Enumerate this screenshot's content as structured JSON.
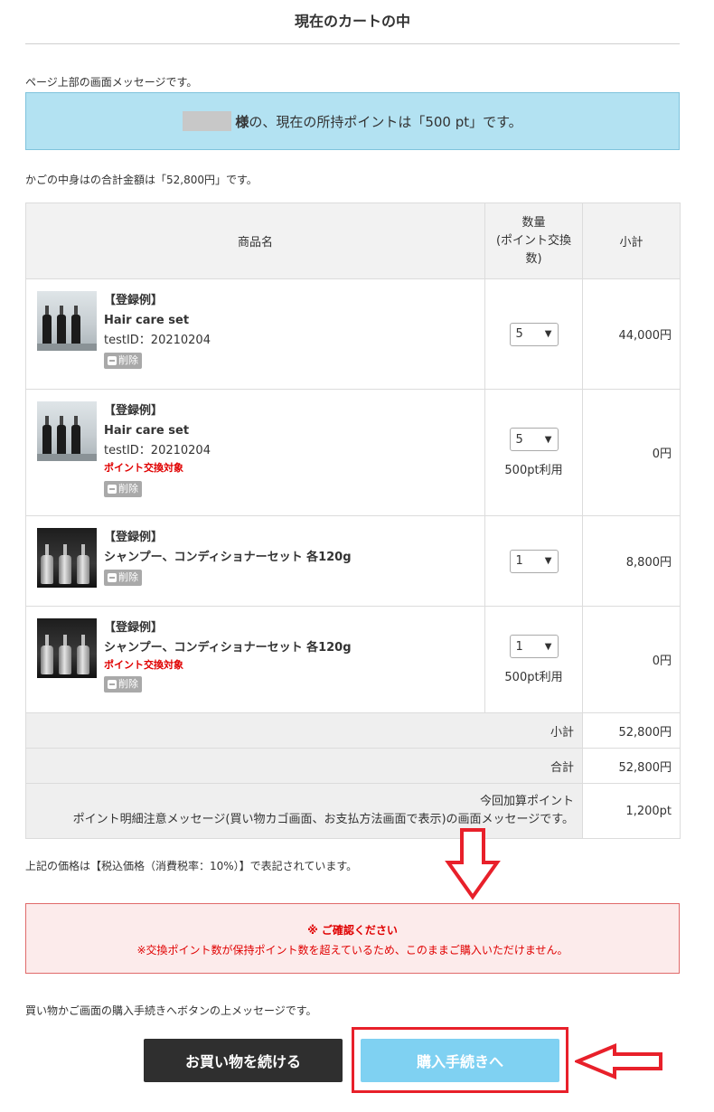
{
  "page": {
    "title": "現在のカートの中"
  },
  "top_message": "ページ上部の画面メッセージです。",
  "points": {
    "name_suffix": "様",
    "text": "の、現在の所持ポイントは「500 pt」です。"
  },
  "cart_total_message": "かごの中身はの合計金額は「52,800円」です。",
  "table": {
    "headers": {
      "name": "商品名",
      "qty": "数量\n(ポイント交換数)",
      "subtotal": "小計"
    },
    "items": [
      {
        "reg": "【登録例】",
        "name": "Hair care set",
        "test_id": "testID：20210204",
        "exchange": "",
        "delete": "削除",
        "qty": "5",
        "pt_use": "",
        "subtotal": "44,000円",
        "thumb": "haircare-bottles"
      },
      {
        "reg": "【登録例】",
        "name": "Hair care set",
        "test_id": "testID：20210204",
        "exchange": "ポイント交換対象",
        "delete": "削除",
        "qty": "5",
        "pt_use": "500pt利用",
        "subtotal": "0円",
        "thumb": "haircare-bottles"
      },
      {
        "reg": "【登録例】",
        "name": "シャンプー、コンディショナーセット 各120g",
        "test_id": "",
        "exchange": "",
        "delete": "削除",
        "qty": "1",
        "pt_use": "",
        "subtotal": "8,800円",
        "thumb": "pump-bottles"
      },
      {
        "reg": "【登録例】",
        "name": "シャンプー、コンディショナーセット 各120g",
        "test_id": "",
        "exchange": "ポイント交換対象",
        "delete": "削除",
        "qty": "1",
        "pt_use": "500pt利用",
        "subtotal": "0円",
        "thumb": "pump-bottles"
      }
    ],
    "subtotal_label": "小計",
    "subtotal_value": "52,800円",
    "total_label": "合計",
    "total_value": "52,800円",
    "points_label_1": "今回加算ポイント",
    "points_label_2": "ポイント明細注意メッセージ(買い物カゴ画面、お支払方法画面で表示)の画面メッセージです。",
    "points_value": "1,200pt"
  },
  "tax_message": "上記の価格は【税込価格（消費税率：10%）】で表記されています。",
  "warning": {
    "title": "※ ご確認ください",
    "text": "※交換ポイント数が保持ポイント数を超えているため、このままご購入いただけません。"
  },
  "button_message": "買い物かご画面の購入手続きへボタンの上メッセージです。",
  "buttons": {
    "continue": "お買い物を続ける",
    "checkout": "購入手続きへ"
  },
  "colors": {
    "info_box": "#b3e2f2",
    "warning_text": "#e00000",
    "checkout_button": "#7fd1f2",
    "annotation_red": "#e8202a"
  }
}
